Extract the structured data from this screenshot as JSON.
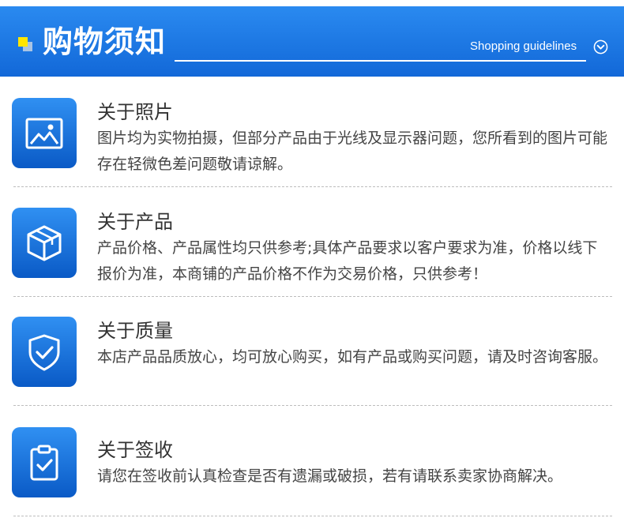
{
  "header": {
    "title": "购物须知",
    "subtitle": "Shopping guidelines",
    "accent_color": "#ffe600",
    "background_color": "#1a76e2"
  },
  "items": [
    {
      "icon": "image-icon",
      "title": "关于照片",
      "description": "图片均为实物拍摄，但部分产品由于光线及显示器问题，您所看到的图片可能存在轻微色差问题敬请谅解。"
    },
    {
      "icon": "box-icon",
      "title": "关于产品",
      "description": "产品价格、产品属性均只供参考;具体产品要求以客户要求为准，价格以线下报价为准，本商铺的产品价格不作为交易价格，只供参考！"
    },
    {
      "icon": "shield-check-icon",
      "title": "关于质量",
      "description": "本店产品品质放心，均可放心购买，如有产品或购买问题，请及时咨询客服。"
    },
    {
      "icon": "clipboard-check-icon",
      "title": "关于签收",
      "description": "请您在签收前认真检查是否有遗漏或破损，若有请联系卖家协商解决。"
    }
  ]
}
